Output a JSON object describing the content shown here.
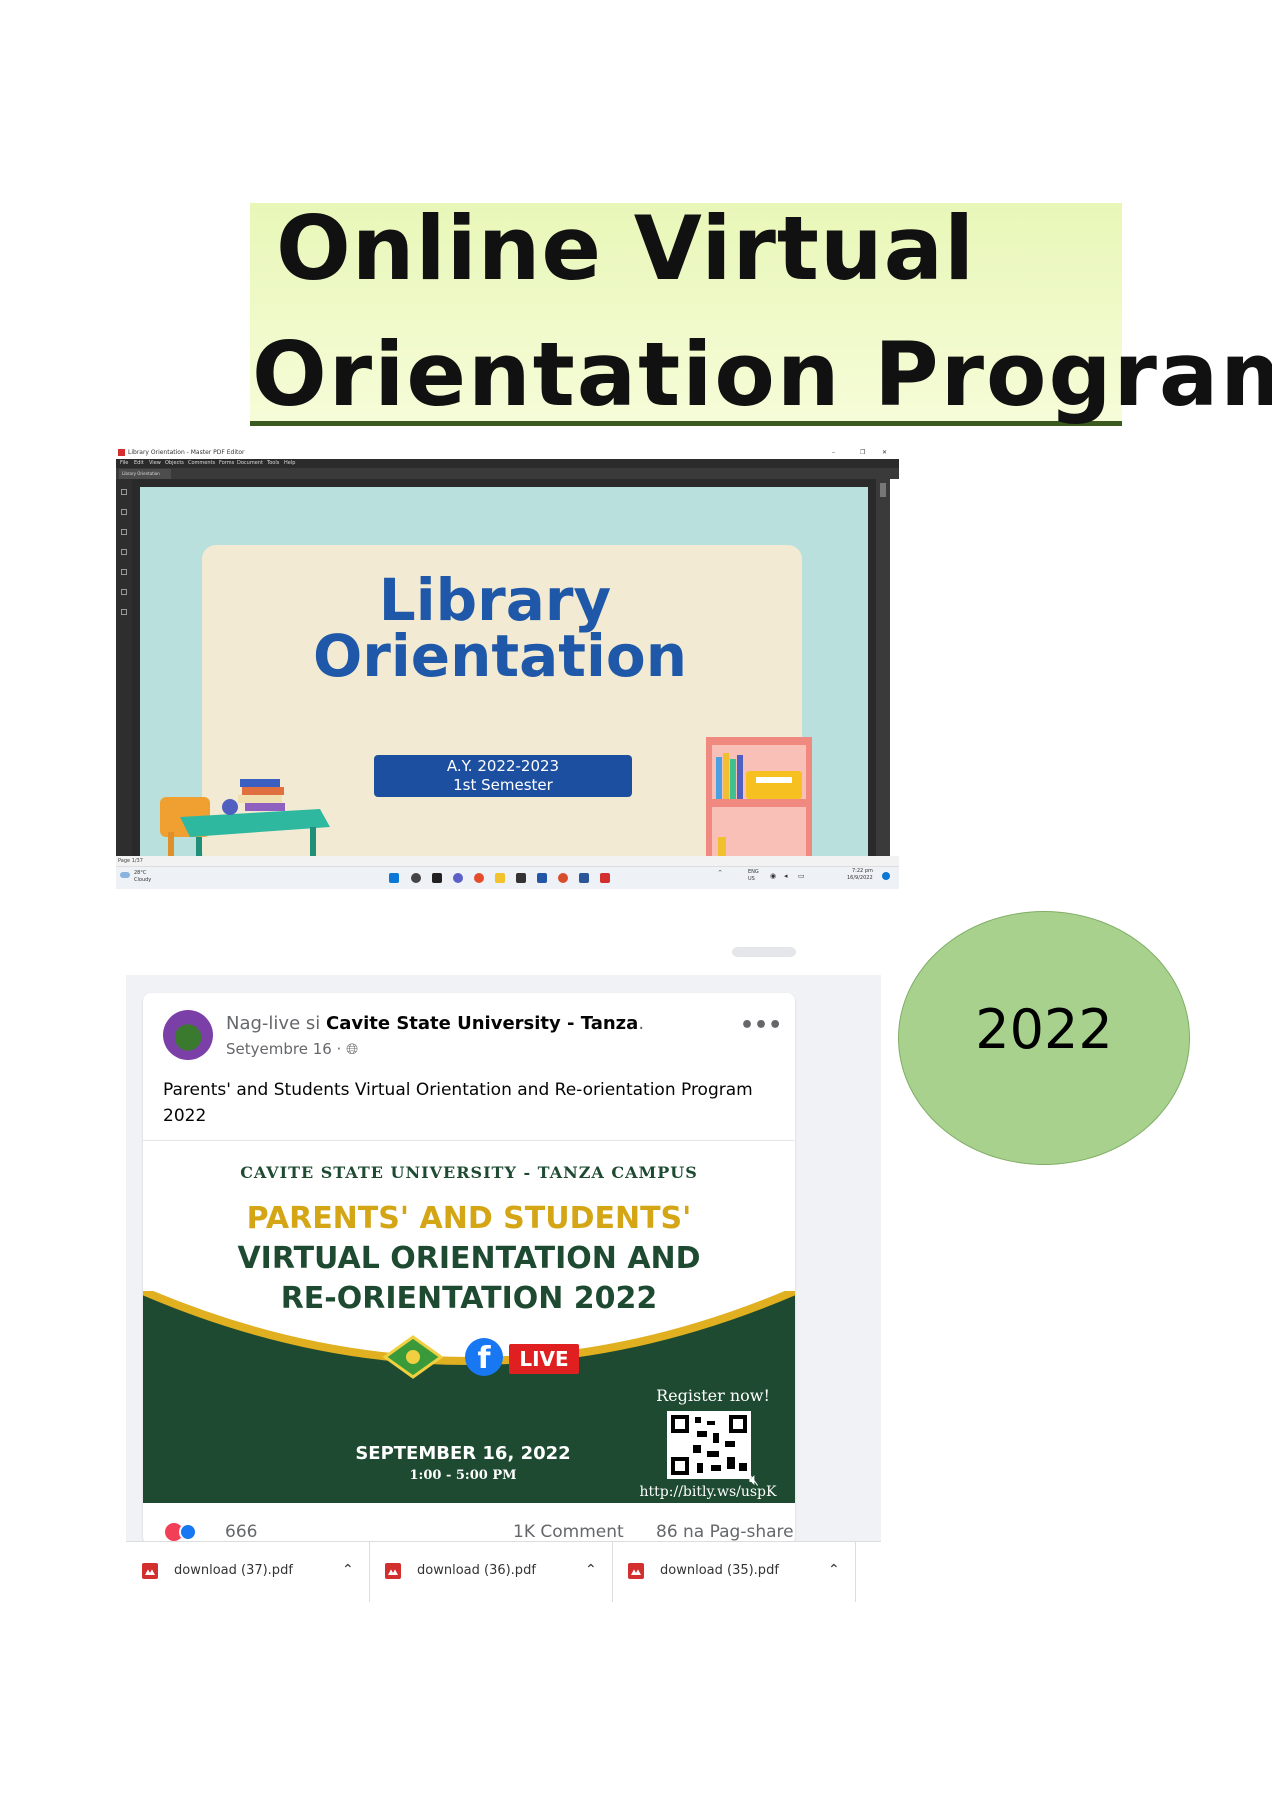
{
  "banner": {
    "line1": "Online Virtual",
    "line2": "Orientation Program"
  },
  "pdf_window": {
    "title": "Library Orientation - Master PDF Editor",
    "menu": [
      "File",
      "Edit",
      "View",
      "Objects",
      "Comments",
      "Forms",
      "Document",
      "Tools",
      "Help"
    ],
    "tab": "Library Orientation",
    "slide": {
      "title_line1": "Library",
      "title_line2": "Orientation",
      "ay_line1": "A.Y. 2022-2023",
      "ay_line2": "1st Semester"
    },
    "status": "Page 1/37",
    "taskbar": {
      "weather_temp": "28°C",
      "weather_desc": "Cloudy",
      "lang1": "ENG",
      "lang2": "US",
      "time": "7:22 pm",
      "date": "16/9/2022"
    }
  },
  "facebook_post": {
    "author_prefix": "Nag-live si",
    "author": "Cavite State University - Tanza",
    "date": "Setyembre 16 ·",
    "more": "•••",
    "caption": "Parents' and Students Virtual Orientation and Re-orientation Program 2022",
    "poster": {
      "campus": "CAVITE STATE UNIVERSITY - TANZA CAMPUS",
      "line1": "PARENTS' AND STUDENTS'",
      "line2": "VIRTUAL ORIENTATION AND",
      "line3": "RE-ORIENTATION 2022",
      "live": "LIVE",
      "register": "Register now!",
      "date": "SEPTEMBER 16, 2022",
      "time": "1:00 - 5:00 PM",
      "url": "http://bitly.ws/uspK"
    },
    "reactions_count": "666",
    "comments": "1K Comment",
    "shares": "86 na Pag-share",
    "colors": {
      "poster_green": "#1e4a31",
      "poster_gold": "#d4a514",
      "fb_blue": "#1877f2"
    }
  },
  "downloads": [
    {
      "name": "download (37).pdf"
    },
    {
      "name": "download (36).pdf"
    },
    {
      "name": "download (35).pdf"
    }
  ],
  "ellipse": {
    "label": "2022",
    "color": "#a8d18d"
  }
}
